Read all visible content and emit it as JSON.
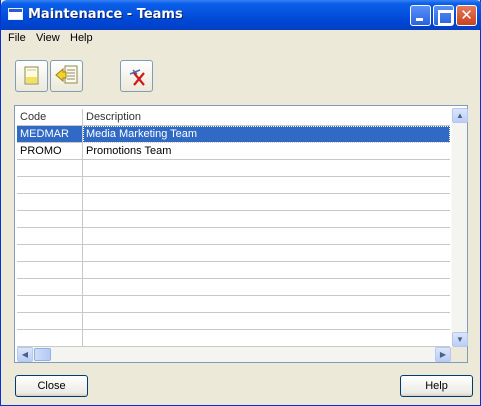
{
  "window": {
    "title": "Maintenance - Teams",
    "controls": {
      "minimize": "minimize",
      "maximize": "maximize",
      "close": "✕"
    }
  },
  "menu": {
    "items": [
      "File",
      "View",
      "Help"
    ]
  },
  "toolbar": {
    "buttons": [
      {
        "name": "new-record",
        "icon": "new-document-icon"
      },
      {
        "name": "open-record",
        "icon": "open-record-icon"
      },
      {
        "name": "delete-record",
        "icon": "delete-icon"
      }
    ]
  },
  "grid": {
    "columns": [
      "Code",
      "Description"
    ],
    "rows": [
      {
        "code": "MEDMAR",
        "description": "Media Marketing Team",
        "selected": true
      },
      {
        "code": "PROMO",
        "description": "Promotions Team",
        "selected": false
      }
    ]
  },
  "footer": {
    "close_label": "Close",
    "help_label": "Help"
  },
  "colors": {
    "titlebar": "#0054e3",
    "selection": "#316ac5",
    "window_bg": "#ece9d8"
  }
}
